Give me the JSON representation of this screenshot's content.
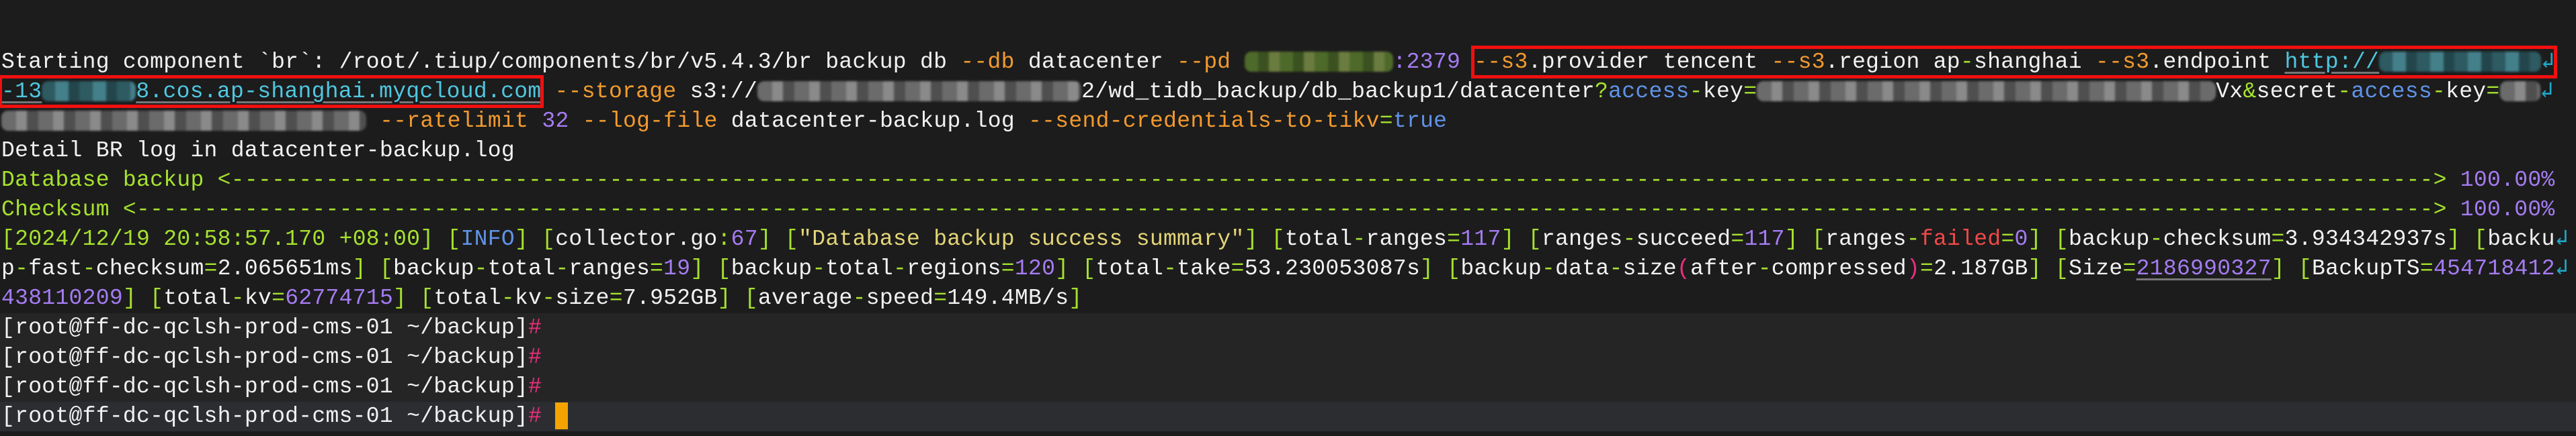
{
  "terminal": {
    "lines": [
      {
        "kind": "out",
        "segs": [
          {
            "t": "Starting component `br`: /root/.tiup/components/br/v5.4.3/br backup db ",
            "c": "w"
          },
          {
            "t": "--db",
            "c": "o"
          },
          {
            "t": " datacenter ",
            "c": "w"
          },
          {
            "t": "--pd",
            "c": "o"
          },
          {
            "t": " ",
            "c": "w"
          },
          {
            "c": "rd gr n11",
            "name": "redacted-pd-address"
          },
          {
            "t": ":2379",
            "c": "p"
          },
          {
            "t": " ",
            "c": "w"
          },
          {
            "box": [
              {
                "t": "--s3",
                "c": "o"
              },
              {
                "t": ".provider tencent ",
                "c": "w"
              },
              {
                "t": "--s3",
                "c": "o"
              },
              {
                "t": ".region ap",
                "c": "w"
              },
              {
                "t": "-",
                "c": "g"
              },
              {
                "t": "shanghai ",
                "c": "w"
              },
              {
                "t": "--s3",
                "c": "o"
              },
              {
                "t": ".endpoint ",
                "c": "w"
              },
              {
                "t": "http://",
                "c": "c u"
              },
              {
                "c": "rd cy n12",
                "name": "redacted-endpoint-host"
              },
              {
                "c": "wrap",
                "icon": "wrap-arrow-icon"
              }
            ]
          }
        ]
      },
      {
        "kind": "out",
        "segs": [
          {
            "box": [
              {
                "t": "-13",
                "c": "c u"
              },
              {
                "c": "rd cy n7",
                "name": "redacted-bucket-id"
              },
              {
                "t": "8.cos.ap-shanghai.myqcloud.com",
                "c": "c u"
              }
            ]
          },
          {
            "t": " --storage",
            "c": "o"
          },
          {
            "t": " s3://",
            "c": "w"
          },
          {
            "c": "rd n24",
            "name": "redacted-bucket-name"
          },
          {
            "t": "2/wd_tidb_backup/db_backup1/datacenter",
            "c": "w"
          },
          {
            "t": "?",
            "c": "g"
          },
          {
            "t": "access",
            "c": "b"
          },
          {
            "t": "-",
            "c": "g"
          },
          {
            "t": "key",
            "c": "w"
          },
          {
            "t": "=",
            "c": "g"
          },
          {
            "c": "rd n34",
            "name": "redacted-access-key"
          },
          {
            "t": "Vx",
            "c": "w"
          },
          {
            "t": "&",
            "c": "g"
          },
          {
            "t": "secret",
            "c": "w"
          },
          {
            "t": "-",
            "c": "g"
          },
          {
            "t": "access",
            "c": "b"
          },
          {
            "t": "-",
            "c": "g"
          },
          {
            "t": "key",
            "c": "w"
          },
          {
            "t": "=",
            "c": "g"
          },
          {
            "c": "rd n3",
            "name": "redacted-secret-key"
          },
          {
            "c": "wrap",
            "icon": "wrap-arrow-icon"
          }
        ]
      },
      {
        "kind": "out",
        "segs": [
          {
            "c": "rd n27",
            "name": "redacted-secret-key-cont"
          },
          {
            "t": " --ratelimit",
            "c": "o"
          },
          {
            "t": " 32",
            "c": "p"
          },
          {
            "t": " --log-file",
            "c": "o"
          },
          {
            "t": " datacenter-backup.log ",
            "c": "w"
          },
          {
            "t": "--send-credentials-to-tikv",
            "c": "o"
          },
          {
            "t": "=",
            "c": "g"
          },
          {
            "t": "true",
            "c": "b"
          }
        ]
      },
      {
        "kind": "out",
        "segs": [
          {
            "t": "Detail BR log in datacenter-backup.log",
            "c": "w"
          }
        ]
      },
      {
        "kind": "out",
        "segs": [
          {
            "t": "Database backup <-------------------------------------------------------------------------------------------------------------------------------------------------------------------",
            "c": "g"
          },
          {
            "t": "> ",
            "c": "g"
          },
          {
            "t": "100.00%",
            "c": "p"
          }
        ]
      },
      {
        "kind": "out",
        "segs": [
          {
            "t": "Checksum <--------------------------------------------------------------------------------------------------------------------------------------------------------------------------",
            "c": "g"
          },
          {
            "t": "> ",
            "c": "g"
          },
          {
            "t": "100.00%",
            "c": "p"
          }
        ]
      },
      {
        "kind": "out",
        "segs": [
          {
            "t": "[",
            "c": "g"
          },
          {
            "t": "2024/12/19 20:58:57.170 +08:00",
            "c": "g"
          },
          {
            "t": "] [",
            "c": "g"
          },
          {
            "t": "INFO",
            "c": "b"
          },
          {
            "t": "] [",
            "c": "g"
          },
          {
            "t": "collector.go",
            "c": "w"
          },
          {
            "t": ":",
            "c": "g"
          },
          {
            "t": "67",
            "c": "p"
          },
          {
            "t": "] [",
            "c": "g"
          },
          {
            "t": "\"Database backup success summary\"",
            "c": "y"
          },
          {
            "t": "] [",
            "c": "g"
          },
          {
            "t": "total",
            "c": "w"
          },
          {
            "t": "-",
            "c": "g"
          },
          {
            "t": "ranges",
            "c": "w"
          },
          {
            "t": "=",
            "c": "g"
          },
          {
            "t": "117",
            "c": "p"
          },
          {
            "t": "] [",
            "c": "g"
          },
          {
            "t": "ranges",
            "c": "w"
          },
          {
            "t": "-",
            "c": "g"
          },
          {
            "t": "succeed",
            "c": "w"
          },
          {
            "t": "=",
            "c": "g"
          },
          {
            "t": "117",
            "c": "p"
          },
          {
            "t": "] [",
            "c": "g"
          },
          {
            "t": "ranges",
            "c": "w"
          },
          {
            "t": "-",
            "c": "g"
          },
          {
            "t": "failed",
            "c": "r"
          },
          {
            "t": "=",
            "c": "g"
          },
          {
            "t": "0",
            "c": "p"
          },
          {
            "t": "] [",
            "c": "g"
          },
          {
            "t": "backup",
            "c": "w"
          },
          {
            "t": "-",
            "c": "g"
          },
          {
            "t": "checksum",
            "c": "w"
          },
          {
            "t": "=",
            "c": "g"
          },
          {
            "t": "3.934342937s",
            "c": "w"
          },
          {
            "t": "] [",
            "c": "g"
          },
          {
            "t": "backu",
            "c": "w"
          },
          {
            "c": "wrap",
            "icon": "wrap-arrow-icon"
          }
        ]
      },
      {
        "kind": "out",
        "segs": [
          {
            "t": "p",
            "c": "w"
          },
          {
            "t": "-",
            "c": "g"
          },
          {
            "t": "fast",
            "c": "w"
          },
          {
            "t": "-",
            "c": "g"
          },
          {
            "t": "checksum",
            "c": "w"
          },
          {
            "t": "=",
            "c": "g"
          },
          {
            "t": "2.065651ms",
            "c": "w"
          },
          {
            "t": "] [",
            "c": "g"
          },
          {
            "t": "backup",
            "c": "w"
          },
          {
            "t": "-",
            "c": "g"
          },
          {
            "t": "total",
            "c": "w"
          },
          {
            "t": "-",
            "c": "g"
          },
          {
            "t": "ranges",
            "c": "w"
          },
          {
            "t": "=",
            "c": "g"
          },
          {
            "t": "19",
            "c": "p"
          },
          {
            "t": "] [",
            "c": "g"
          },
          {
            "t": "backup",
            "c": "w"
          },
          {
            "t": "-",
            "c": "g"
          },
          {
            "t": "total",
            "c": "w"
          },
          {
            "t": "-",
            "c": "g"
          },
          {
            "t": "regions",
            "c": "w"
          },
          {
            "t": "=",
            "c": "g"
          },
          {
            "t": "120",
            "c": "p"
          },
          {
            "t": "] [",
            "c": "g"
          },
          {
            "t": "total",
            "c": "w"
          },
          {
            "t": "-",
            "c": "g"
          },
          {
            "t": "take",
            "c": "w"
          },
          {
            "t": "=",
            "c": "g"
          },
          {
            "t": "53.230053087s",
            "c": "w"
          },
          {
            "t": "] [",
            "c": "g"
          },
          {
            "t": "backup",
            "c": "w"
          },
          {
            "t": "-",
            "c": "g"
          },
          {
            "t": "data",
            "c": "w"
          },
          {
            "t": "-",
            "c": "g"
          },
          {
            "t": "size",
            "c": "w"
          },
          {
            "t": "(",
            "c": "k"
          },
          {
            "t": "after",
            "c": "w"
          },
          {
            "t": "-",
            "c": "g"
          },
          {
            "t": "compressed",
            "c": "w"
          },
          {
            "t": ")",
            "c": "k"
          },
          {
            "t": "=",
            "c": "g"
          },
          {
            "t": "2.187GB",
            "c": "w"
          },
          {
            "t": "] [",
            "c": "g"
          },
          {
            "t": "Size",
            "c": "w"
          },
          {
            "t": "=",
            "c": "g"
          },
          {
            "t": "2186990327",
            "c": "p u"
          },
          {
            "t": "] [",
            "c": "g"
          },
          {
            "t": "BackupTS",
            "c": "w"
          },
          {
            "t": "=",
            "c": "g"
          },
          {
            "t": "454718412",
            "c": "p"
          },
          {
            "c": "wrap",
            "icon": "wrap-arrow-icon"
          }
        ]
      },
      {
        "kind": "out",
        "segs": [
          {
            "t": "438110209",
            "c": "p"
          },
          {
            "t": "] [",
            "c": "g"
          },
          {
            "t": "total",
            "c": "w"
          },
          {
            "t": "-",
            "c": "g"
          },
          {
            "t": "kv",
            "c": "w"
          },
          {
            "t": "=",
            "c": "g"
          },
          {
            "t": "62774715",
            "c": "p"
          },
          {
            "t": "] [",
            "c": "g"
          },
          {
            "t": "total",
            "c": "w"
          },
          {
            "t": "-",
            "c": "g"
          },
          {
            "t": "kv",
            "c": "w"
          },
          {
            "t": "-",
            "c": "g"
          },
          {
            "t": "size",
            "c": "w"
          },
          {
            "t": "=",
            "c": "g"
          },
          {
            "t": "7.952GB",
            "c": "w"
          },
          {
            "t": "] [",
            "c": "g"
          },
          {
            "t": "average",
            "c": "w"
          },
          {
            "t": "-",
            "c": "g"
          },
          {
            "t": "speed",
            "c": "w"
          },
          {
            "t": "=",
            "c": "g"
          },
          {
            "t": "149.4MB/s",
            "c": "w"
          },
          {
            "t": "]",
            "c": "g"
          }
        ]
      },
      {
        "kind": "prompt",
        "segs": [
          {
            "t": "[root@ff-dc-qclsh-prod-cms-01 ~/backup]",
            "c": "w"
          },
          {
            "t": "#",
            "c": "k"
          }
        ]
      },
      {
        "kind": "prompt",
        "segs": [
          {
            "t": "[root@ff-dc-qclsh-prod-cms-01 ~/backup]",
            "c": "w"
          },
          {
            "t": "#",
            "c": "k"
          }
        ]
      },
      {
        "kind": "prompt",
        "segs": [
          {
            "t": "[root@ff-dc-qclsh-prod-cms-01 ~/backup]",
            "c": "w"
          },
          {
            "t": "#",
            "c": "k"
          }
        ]
      },
      {
        "kind": "active",
        "segs": [
          {
            "t": "[root@ff-dc-qclsh-prod-cms-01 ~/backup]",
            "c": "w"
          },
          {
            "t": "#",
            "c": "k"
          },
          {
            "c": "cursor",
            "name": "text-cursor"
          }
        ]
      }
    ]
  }
}
